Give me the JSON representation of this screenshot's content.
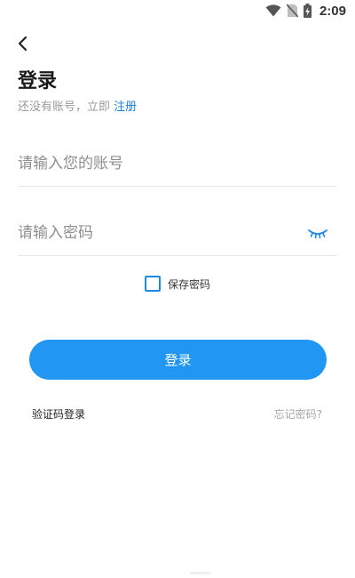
{
  "status_bar": {
    "time": "2:09",
    "icons": [
      "wifi-icon",
      "no-sim-icon",
      "battery-charging-icon"
    ]
  },
  "header": {
    "back_icon": "chevron-left-icon",
    "title": "登录",
    "subtitle_prefix": "还没有账号，立即",
    "register_link": "注册"
  },
  "form": {
    "account_placeholder": "请输入您的账号",
    "account_value": "",
    "password_placeholder": "请输入密码",
    "password_value": "",
    "password_toggle_icon": "eye-closed-icon",
    "remember_label": "保存密码",
    "remember_checked": false,
    "submit_label": "登录"
  },
  "footer_links": {
    "sms_login": "验证码登录",
    "forgot_password": "忘记密码?"
  },
  "colors": {
    "accent": "#2196f3",
    "link": "#1e7fd6",
    "placeholder": "#8e8e8e",
    "muted": "#a5a5a5"
  }
}
